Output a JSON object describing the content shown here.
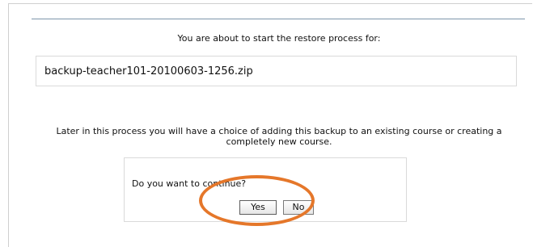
{
  "restore": {
    "intro": "You are about to start the restore process for:",
    "filename": "backup-teacher101-20100603-1256.zip",
    "later_text": "Later in this process you will have a choice of adding this backup to an existing course or creating a completely new course."
  },
  "confirm": {
    "question": "Do you want to continue?",
    "yes_label": "Yes",
    "no_label": "No"
  },
  "colors": {
    "highlight": "#e5772a",
    "rule": "#7d96aa",
    "border": "#dadada"
  }
}
